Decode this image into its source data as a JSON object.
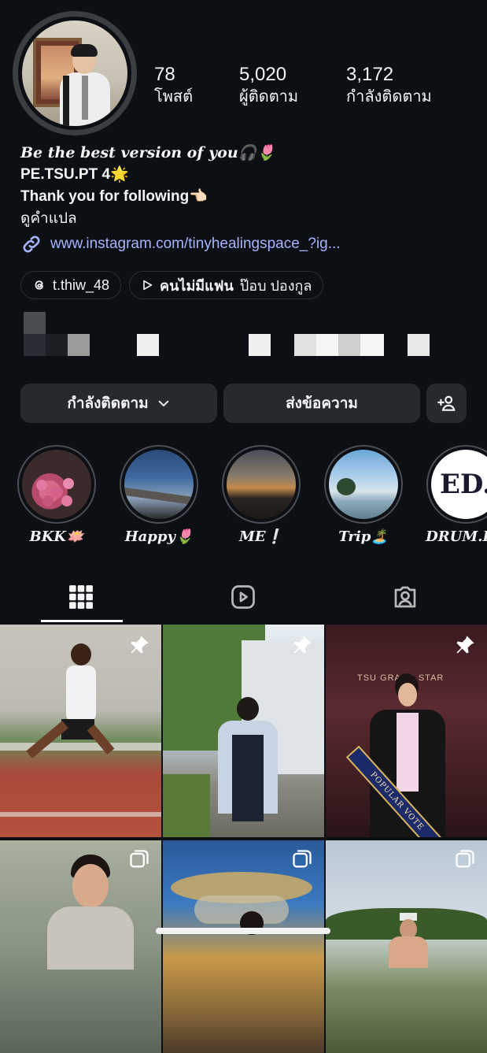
{
  "profile": {
    "stats": [
      {
        "value": "78",
        "label": "โพสต์"
      },
      {
        "value": "5,020",
        "label": "ผู้ติดตาม"
      },
      {
        "value": "3,172",
        "label": "กำลังติดตาม"
      }
    ],
    "bio": {
      "line1": "Be the best version of  you🎧🌷",
      "line2": "PE.TSU.PT 4🌟",
      "line3": "Thank you for following👈🏻",
      "translate": "ดูคำแปล",
      "link": "www.instagram.com/tinyhealingspace_?ig..."
    },
    "chips": {
      "threads": "t.thiw_48",
      "music_title": "คนไม่มีแฟน",
      "music_artist": "ป๊อบ ปองกูล"
    }
  },
  "actions": {
    "following": "กำลังติดตาม",
    "message": "ส่งข้อความ"
  },
  "highlights": [
    {
      "label": "BKK🪷"
    },
    {
      "label": "Happy🌷"
    },
    {
      "label": "ME❕"
    },
    {
      "label": "Trip🏝️"
    },
    {
      "label": "DRUM.ED"
    }
  ],
  "highlight_logo_text": "ED.",
  "posts": {
    "sash_text": "POPULAR VOTE",
    "backdrop_text": "TSU GRAND STAR"
  },
  "icons": [
    "chevron-down-icon",
    "add-person-icon",
    "threads-icon",
    "play-icon",
    "link-icon",
    "grid-icon",
    "reels-icon",
    "tagged-icon",
    "pin-icon",
    "multiple-icon"
  ]
}
